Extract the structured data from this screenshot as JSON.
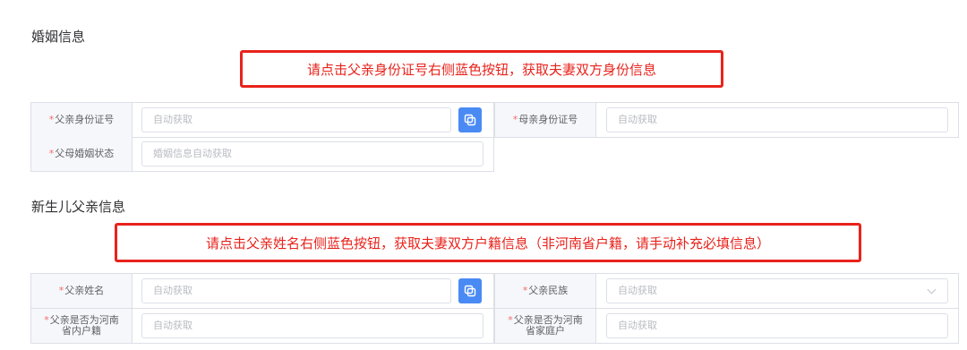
{
  "marriage": {
    "title": "婚姻信息",
    "notice": "请点击父亲身份证号右侧蓝色按钮，获取夫妻双方身份信息",
    "father_id_label": "父亲身份证号",
    "father_id_placeholder": "自动获取",
    "mother_id_label": "母亲身份证号",
    "mother_id_placeholder": "自动获取",
    "status_label": "父母婚姻状态",
    "status_placeholder": "婚姻信息自动获取"
  },
  "father": {
    "title": "新生儿父亲信息",
    "notice": "请点击父亲姓名右侧蓝色按钮，获取夫妻双方户籍信息（非河南省户籍，请手动补充必填信息）",
    "name_label": "父亲姓名",
    "name_placeholder": "自动获取",
    "ethnicity_label": "父亲民族",
    "ethnicity_placeholder": "自动获取",
    "henan_huji_label_line1": "父亲是否为河南",
    "henan_huji_label_line2": "省内户籍",
    "henan_huji_placeholder": "自动获取",
    "henan_family_label_line1": "父亲是否为河南",
    "henan_family_label_line2": "省家庭户",
    "henan_family_placeholder": "自动获取"
  },
  "required_mark": "*",
  "colors": {
    "accent": "#4a8af4",
    "notice": "#e8231c",
    "required": "#f56c6c"
  }
}
